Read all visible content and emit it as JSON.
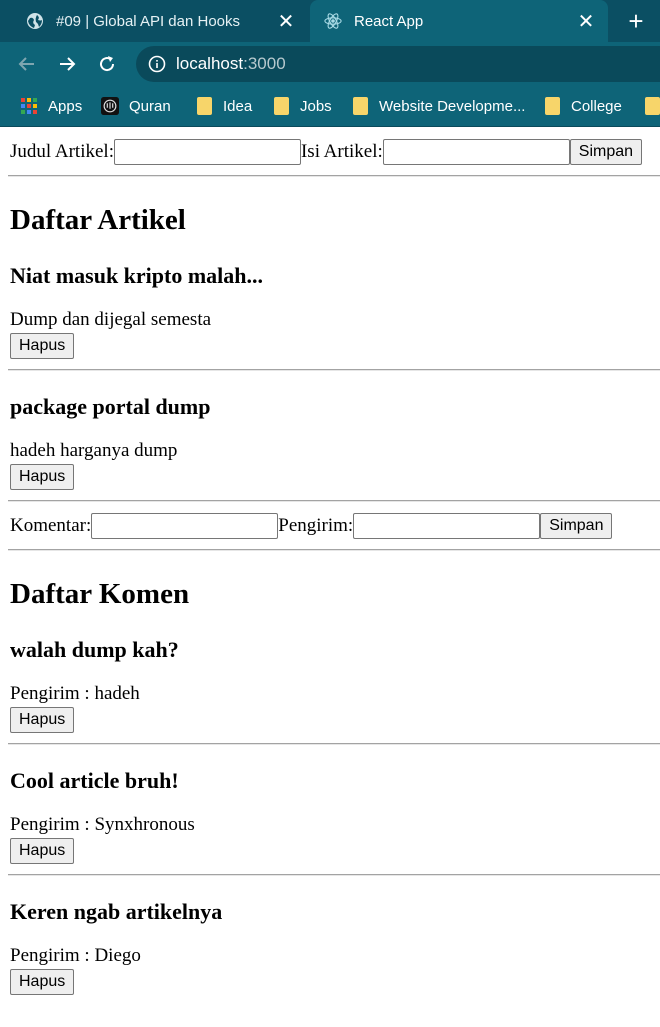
{
  "browser": {
    "tabs": [
      {
        "title": "#09 | Global API dan Hooks",
        "icon": "globe-icon",
        "active": false
      },
      {
        "title": "React App",
        "icon": "react-icon",
        "active": true
      }
    ],
    "address": {
      "host": "localhost",
      "port": ":3000"
    },
    "bookmarks": [
      {
        "label": "Apps",
        "icon": "apps-grid-icon"
      },
      {
        "label": "Quran",
        "icon": "quran-icon"
      },
      {
        "label": "Idea",
        "icon": "folder-icon"
      },
      {
        "label": "Jobs",
        "icon": "folder-icon"
      },
      {
        "label": "Website Developme...",
        "icon": "folder-icon"
      },
      {
        "label": "College",
        "icon": "folder-icon"
      }
    ],
    "colors": {
      "tabbar": "#0b4f63",
      "toolbar": "#0e6478"
    }
  },
  "article_form": {
    "title_label": "Judul Artikel:",
    "title_value": "",
    "content_label": "Isi Artikel:",
    "content_value": "",
    "submit_label": "Simpan"
  },
  "articles": {
    "heading": "Daftar Artikel",
    "items": [
      {
        "title": "Niat masuk kripto malah...",
        "body": "Dump dan dijegal semesta",
        "delete_label": "Hapus"
      },
      {
        "title": "package portal dump",
        "body": "hadeh harganya dump",
        "delete_label": "Hapus"
      }
    ]
  },
  "comment_form": {
    "comment_label": "Komentar:",
    "comment_value": "",
    "sender_label": "Pengirim:",
    "sender_value": "",
    "submit_label": "Simpan"
  },
  "comments": {
    "heading": "Daftar Komen",
    "items": [
      {
        "text": "walah dump kah?",
        "sender": "Pengirim : hadeh",
        "delete_label": "Hapus"
      },
      {
        "text": "Cool article bruh!",
        "sender": "Pengirim : Synxhronous",
        "delete_label": "Hapus"
      },
      {
        "text": "Keren ngab artikelnya",
        "sender": "Pengirim : Diego",
        "delete_label": "Hapus"
      }
    ]
  }
}
